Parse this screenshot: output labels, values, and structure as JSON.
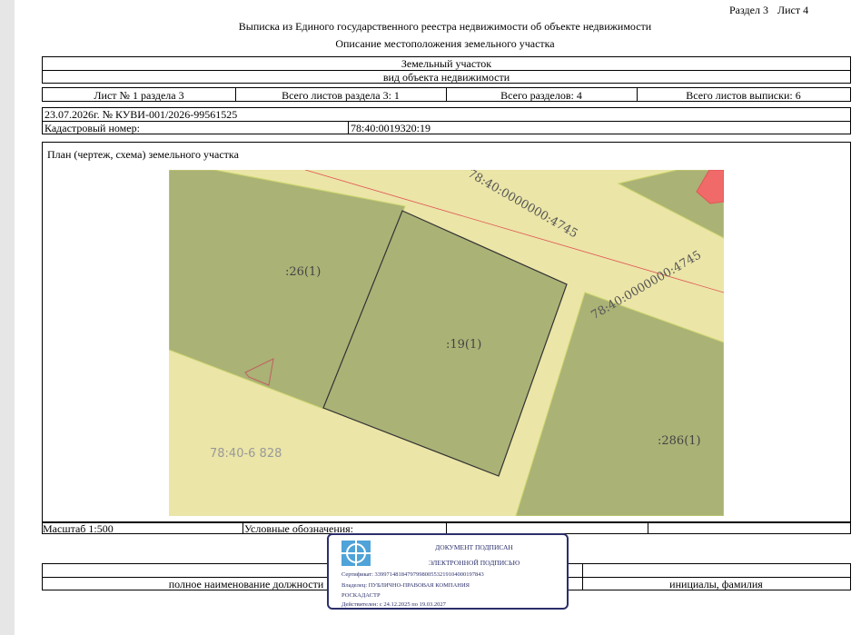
{
  "page_header": {
    "section": "Раздел 3",
    "sheet": "Лист 4"
  },
  "titles": {
    "main": "Выписка из Единого государственного реестра недвижимости об объекте недвижимости",
    "sub": "Описание местоположения земельного участка"
  },
  "object": {
    "type": "Земельный участок",
    "type_caption": "вид объекта недвижимости"
  },
  "sheet_row": {
    "sheet_no": "Лист № 1 раздела 3",
    "total_sheets_section": "Всего листов раздела 3: 1",
    "total_sections": "Всего разделов: 4",
    "total_sheets": "Всего листов выписки: 6"
  },
  "doc_number": "23.07.2026г. № КУВИ-001/2026-99561525",
  "cadastral": {
    "label": "Кадастровый номер:",
    "value": "78:40:0019320:19"
  },
  "plan": {
    "title": "План (чертеж, схема) земельного участка",
    "labels": {
      "parcel_26": ":26(1)",
      "parcel_19": ":19(1)",
      "parcel_286": ":286(1)",
      "road_1": "78:40:0000000:4745",
      "road_2": "78:40:0000000:4745",
      "quarter": "78:40-6 828"
    },
    "colors": {
      "background": "#ebe5a7",
      "parcel": "#aab276",
      "parcel_border": "#c9d36a",
      "main_border": "#333",
      "red_line": "#e25555",
      "pink": "#f06a6a"
    }
  },
  "footer": {
    "scale": "Масштаб 1:500",
    "legend": "Условные обозначения:",
    "position": "полное наименование должности",
    "name": "инициалы, фамилия"
  },
  "stamp": {
    "line1": "ДОКУМЕНТ ПОДПИСАН",
    "line2": "ЭЛЕКТРОННОЙ ПОДПИСЬЮ",
    "certificate": "Сертификат: 3399714818479799800553219104000197843",
    "owner": "Владелец: ПУБЛИЧНО-ПРАВОВАЯ КОМПАНИЯ",
    "owner2": "РОСКАДАСТР",
    "valid": "Действителен: с 24.12.2025 по 19.03.2027",
    "color": "#2b2f6b"
  }
}
